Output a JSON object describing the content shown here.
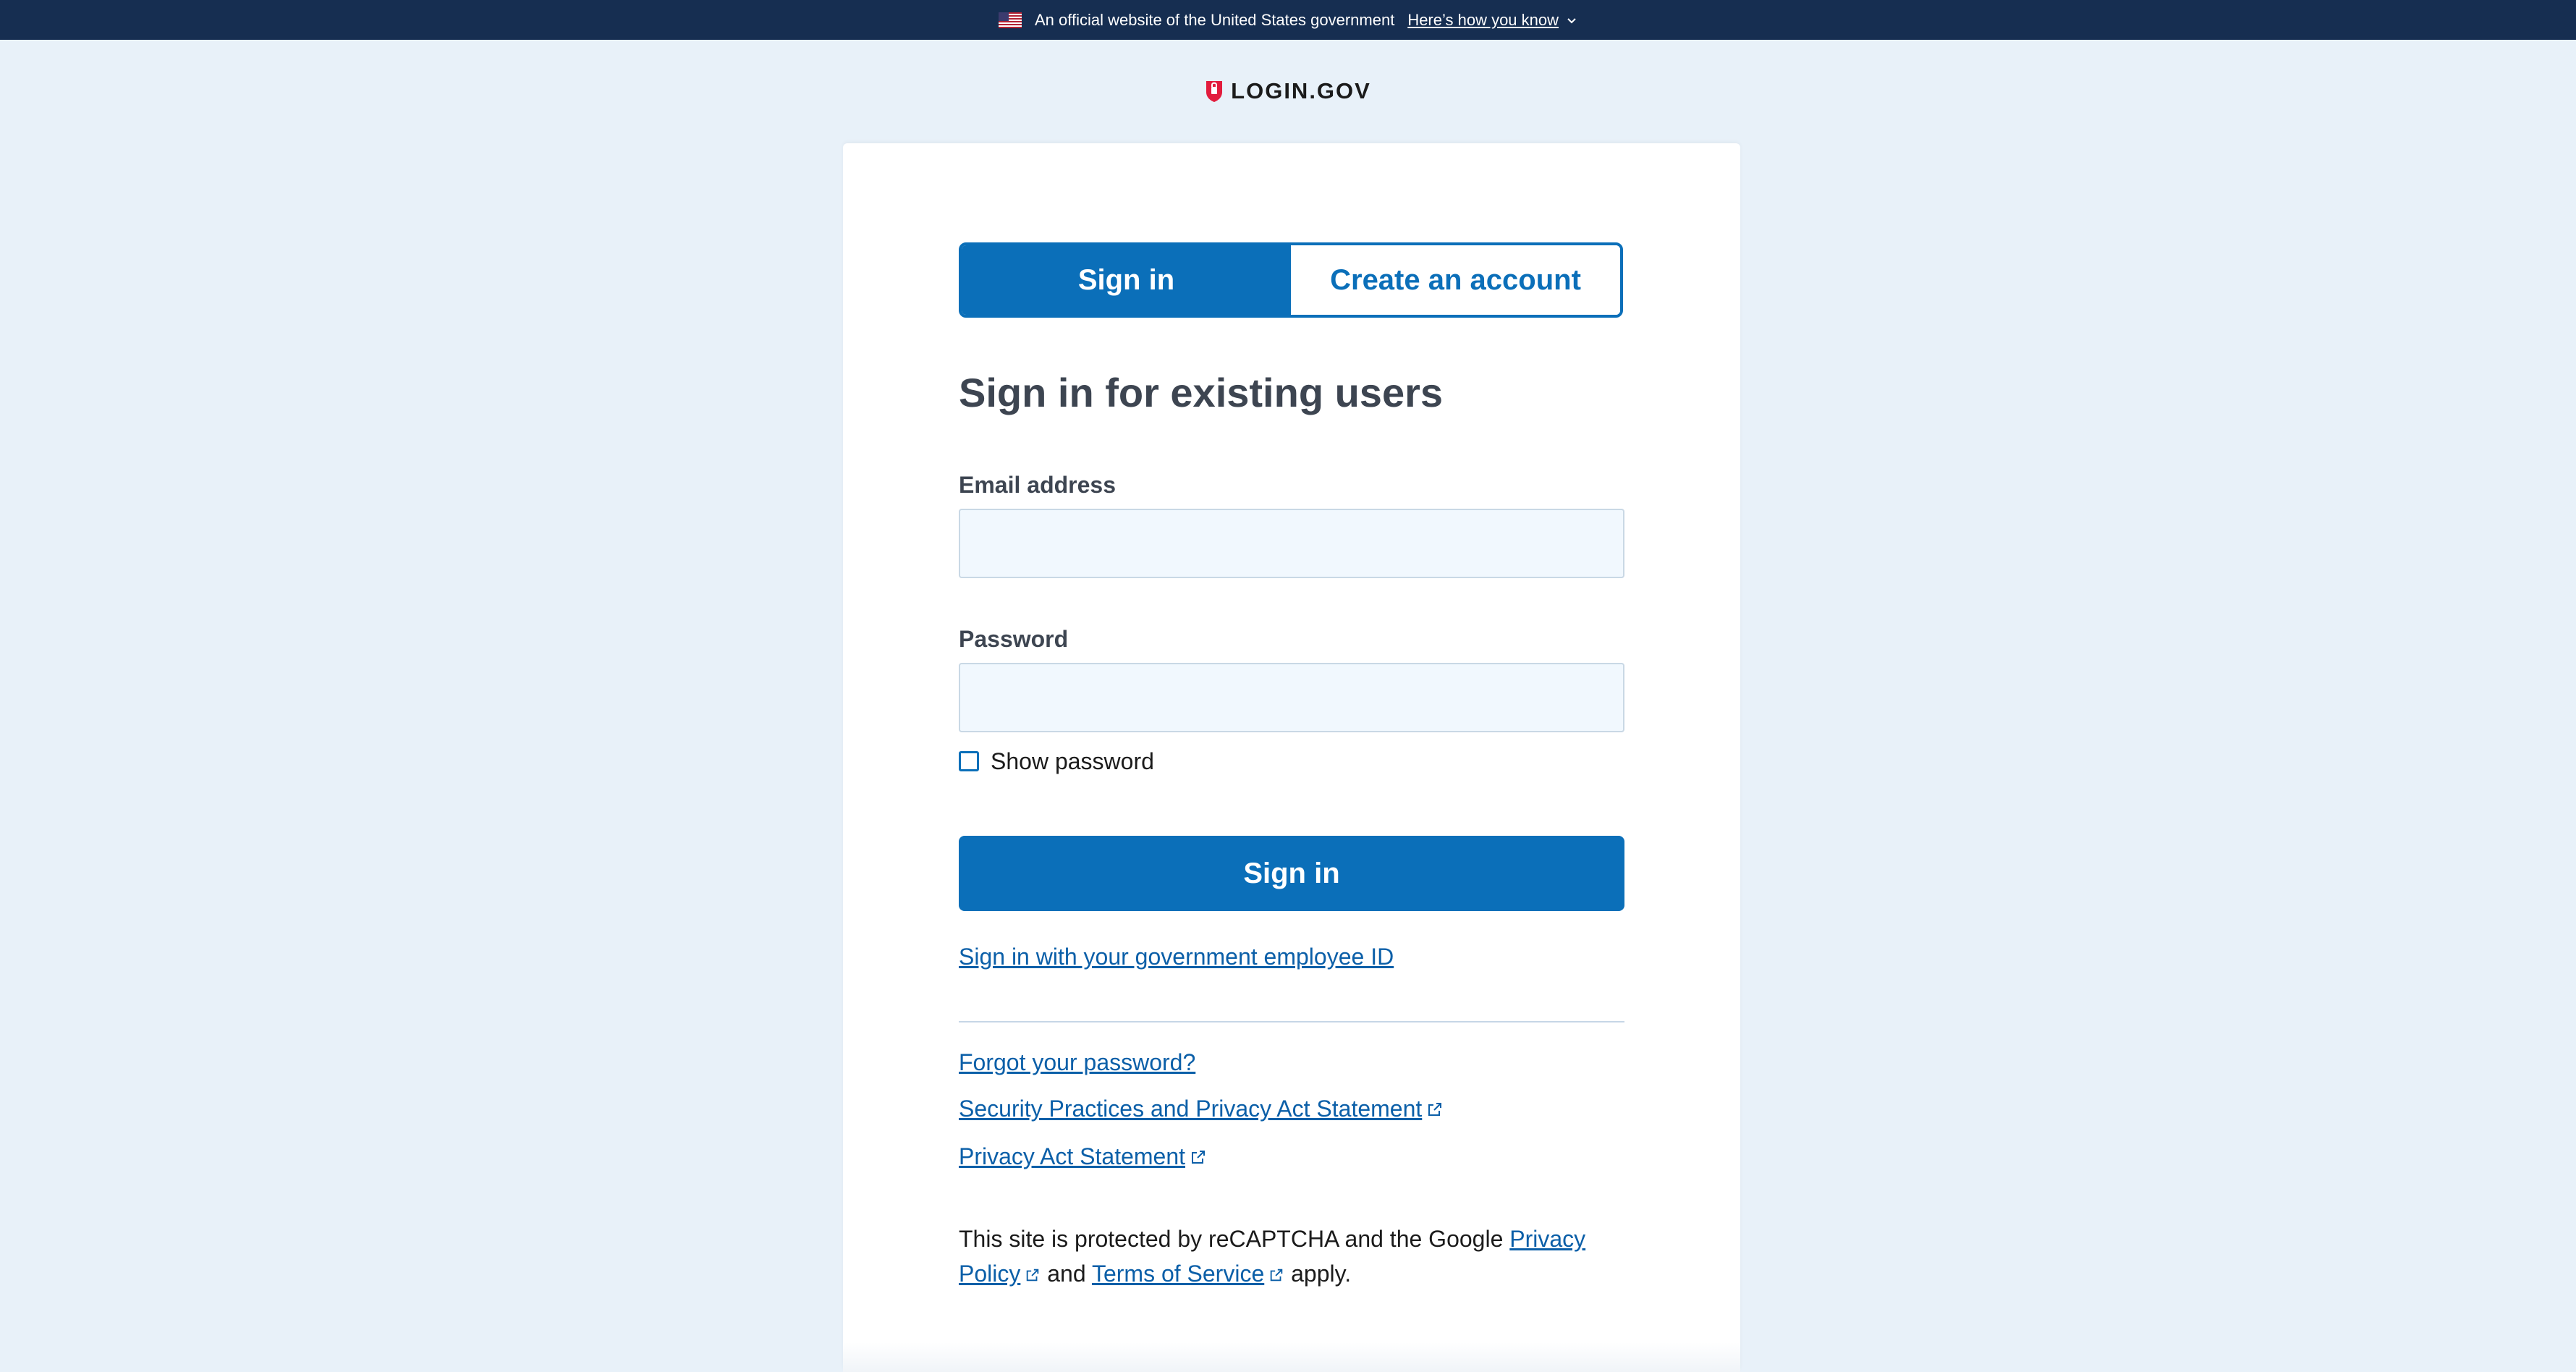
{
  "banner": {
    "text": "An official website of the United States government",
    "link": "Here’s how you know"
  },
  "logo": {
    "wordmark": "LOGIN.GOV"
  },
  "tabs": [
    {
      "label": "Sign in",
      "active": true
    },
    {
      "label": "Create an account",
      "active": false
    }
  ],
  "heading": "Sign in for existing users",
  "form": {
    "email_label": "Email address",
    "email_value": "",
    "password_label": "Password",
    "password_value": "",
    "show_password_label": "Show password",
    "show_password_checked": false,
    "submit_label": "Sign in"
  },
  "links": {
    "piv": "Sign in with your government employee ID",
    "forgot": "Forgot your password?",
    "security": "Security Practices and Privacy Act Statement",
    "privacy_act": "Privacy Act Statement"
  },
  "recaptcha": {
    "prefix": "This site is protected by reCAPTCHA and the Google ",
    "privacy_policy": "Privacy Policy",
    "and": " and ",
    "terms": "Terms of Service",
    "suffix": " apply."
  },
  "colors": {
    "banner_bg": "#162e51",
    "page_bg": "#e8f1f9",
    "primary": "#0b6fb9",
    "link": "#0b5fa8",
    "logo_red": "#e21c3d"
  },
  "icons": [
    "us-flag-icon",
    "chevron-down-icon",
    "login-shield-icon",
    "external-link-icon"
  ]
}
